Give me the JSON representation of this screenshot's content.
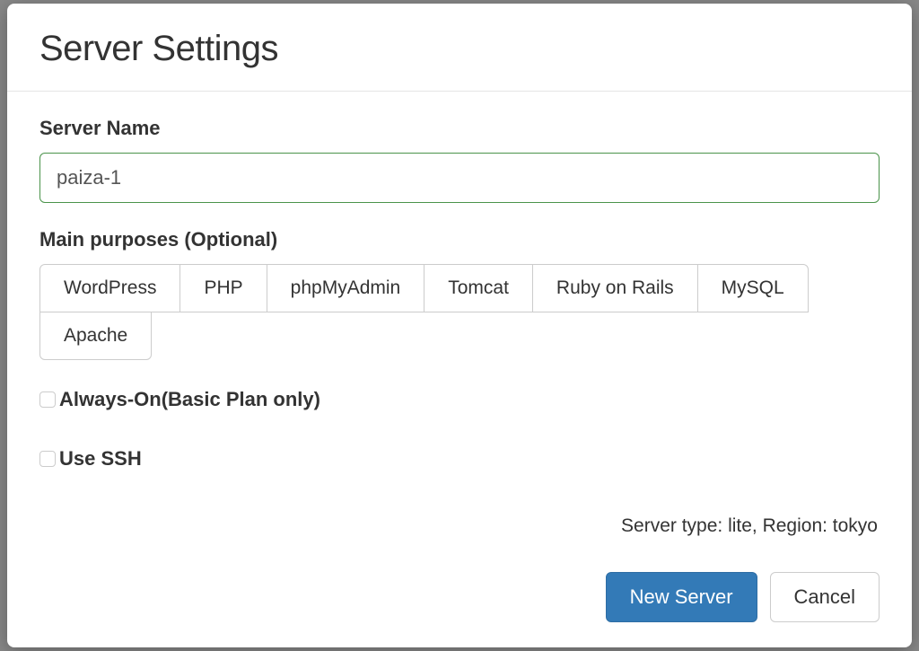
{
  "modal": {
    "title": "Server Settings"
  },
  "form": {
    "server_name_label": "Server Name",
    "server_name_value": "paiza-1",
    "purposes_label": "Main purposes (Optional)",
    "purposes": [
      "WordPress",
      "PHP",
      "phpMyAdmin",
      "Tomcat",
      "Ruby on Rails",
      "MySQL",
      "Apache"
    ],
    "always_on_label": "Always-On(Basic Plan only)",
    "use_ssh_label": "Use SSH",
    "server_info": "Server type: lite, Region: tokyo"
  },
  "footer": {
    "new_server_label": "New Server",
    "cancel_label": "Cancel"
  }
}
